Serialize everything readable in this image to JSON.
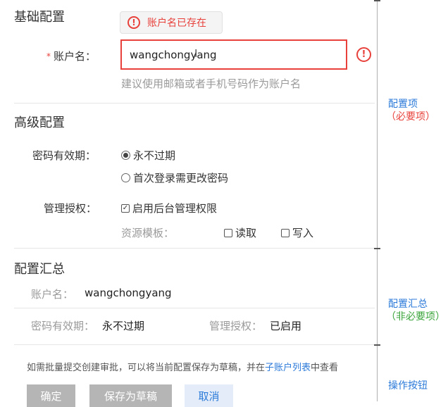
{
  "basic": {
    "title": "基础配置",
    "error_tip": "账户名已存在",
    "required_mark": "*",
    "account_label": "账户名：",
    "account_value": "wangchongyang",
    "hint": "建议使用邮箱或者手机号码作为账户名"
  },
  "advanced": {
    "title": "高级配置",
    "pwd_label": "密码有效期：",
    "pwd_options": [
      {
        "label": "永不过期",
        "selected": true
      },
      {
        "label": "首次登录需更改密码",
        "selected": false
      }
    ],
    "auth_label": "管理授权：",
    "auth_checkbox": {
      "label": "启用后台管理权限",
      "checked": true
    },
    "resource_label": "资源模板：",
    "resource_options": [
      {
        "label": "读取",
        "checked": false
      },
      {
        "label": "写入",
        "checked": false
      }
    ]
  },
  "summary": {
    "title": "配置汇总",
    "account_label": "账户名：",
    "account_value": "wangchongyang",
    "pwd_label": "密码有效期：",
    "pwd_value": "永不过期",
    "auth_label": "管理授权：",
    "auth_value": "已启用"
  },
  "footer": {
    "note_prefix": "如需批量提交创建审批，可以将当前配置保存为草稿，并在",
    "note_link": "子账户列表",
    "note_suffix": "中查看",
    "buttons": {
      "confirm": "确定",
      "save_draft": "保存为草稿",
      "cancel": "取消"
    }
  },
  "annotations": {
    "config_items": "配置项",
    "config_items_req": "（必要项）",
    "summary": "配置汇总",
    "summary_opt": "（非必要项）",
    "buttons": "操作按钮"
  },
  "colors": {
    "error": "#e8413b",
    "link": "#2b7ad9",
    "annot_blue": "#2b7ad9",
    "annot_red": "#e8413b",
    "annot_green": "#3aa43a"
  }
}
